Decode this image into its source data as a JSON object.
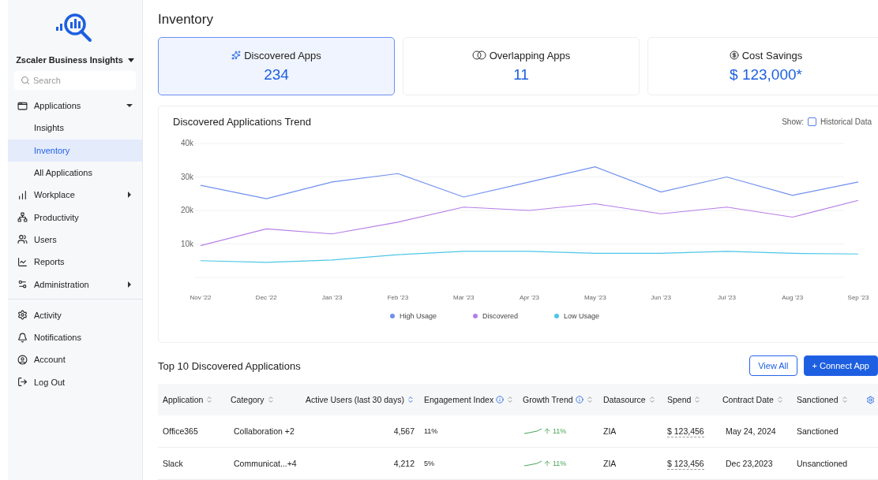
{
  "sidebar": {
    "brand": "Zscaler Business Insights",
    "search": {
      "placeholder": "Search"
    },
    "items": [
      {
        "label": "Applications",
        "expanded": true,
        "children": [
          {
            "label": "Insights",
            "selected": false
          },
          {
            "label": "Inventory",
            "selected": true
          },
          {
            "label": "All Applications",
            "selected": false
          }
        ]
      },
      {
        "label": "Workplace",
        "expanded": false
      },
      {
        "label": "Productivity"
      },
      {
        "label": "Users"
      },
      {
        "label": "Reports"
      },
      {
        "label": "Administration",
        "expanded": false
      }
    ],
    "footer_items": [
      {
        "label": "Activity"
      },
      {
        "label": "Notifications"
      },
      {
        "label": "Account"
      },
      {
        "label": "Log Out"
      }
    ]
  },
  "page_title": "Inventory",
  "cards": [
    {
      "label": "Discovered Apps",
      "value": "234",
      "selected": true
    },
    {
      "label": "Overlapping Apps",
      "value": "11",
      "selected": false
    },
    {
      "label": "Cost Savings",
      "value": "$ 123,000*",
      "selected": false
    }
  ],
  "trend": {
    "title": "Discovered Applications Trend",
    "show_label": "Show:",
    "historical": {
      "label": "Historical Data",
      "checked": false
    },
    "chart_data": {
      "type": "line",
      "x": [
        "Nov '22",
        "Dec '22",
        "Jan '23",
        "Feb '23",
        "Mar '23",
        "Apr '23",
        "May '23",
        "Jun '23",
        "Jul '23",
        "Aug '23",
        "Sep '23"
      ],
      "ylim": [
        0,
        40000
      ],
      "grid": true,
      "yticks": [
        {
          "value": 10000,
          "label": "10k"
        },
        {
          "value": 20000,
          "label": "20k"
        },
        {
          "value": 30000,
          "label": "30k"
        },
        {
          "value": 40000,
          "label": "40k"
        }
      ],
      "series": [
        {
          "name": "High Usage",
          "color": "#6f8ff0",
          "values": [
            27500,
            23500,
            28500,
            31000,
            24000,
            28500,
            33000,
            25500,
            30000,
            24500,
            28500
          ]
        },
        {
          "name": "Discovered",
          "color": "#b57ee8",
          "values": [
            9500,
            14500,
            13000,
            16500,
            21000,
            20000,
            22000,
            19000,
            21000,
            18000,
            23000
          ]
        },
        {
          "name": "Low Usage",
          "color": "#4ec6e8",
          "values": [
            5000,
            4500,
            5200,
            6800,
            7800,
            7800,
            7200,
            7200,
            7800,
            7200,
            7000
          ]
        }
      ]
    }
  },
  "table": {
    "title": "Top 10 Discovered Applications",
    "buttons": [
      {
        "label": "View All",
        "kind": "outline"
      },
      {
        "label": "+  Connect App",
        "kind": "primary"
      }
    ],
    "columns": [
      {
        "label": "Application",
        "sorted": false,
        "info": false
      },
      {
        "label": "Category",
        "sorted": false,
        "info": false
      },
      {
        "label": "Active Users (last 30 days)",
        "sorted": true,
        "info": false
      },
      {
        "label": "Engagement Index",
        "sorted": false,
        "info": true
      },
      {
        "label": "Growth Trend",
        "sorted": false,
        "info": true
      },
      {
        "label": "Datasource",
        "sorted": false,
        "info": false
      },
      {
        "label": "Spend",
        "sorted": false,
        "info": false
      },
      {
        "label": "Contract Date",
        "sorted": false,
        "info": false
      },
      {
        "label": "Sanctioned",
        "sorted": false,
        "info": false
      }
    ],
    "rows": [
      {
        "application": "Office365",
        "category": "Collaboration +2",
        "active_users": "4,567",
        "engagement": "11%",
        "growth": "11%",
        "datasource": "ZIA",
        "spend": "$ 123,456",
        "contract_date": "May 24, 2024",
        "sanctioned": "Sanctioned"
      },
      {
        "application": "Slack",
        "category": "Communicat...+4",
        "active_users": "4,212",
        "engagement": "5%",
        "growth": "11%",
        "datasource": "ZIA",
        "spend": "$ 123,456",
        "contract_date": "Dec 23,2023",
        "sanctioned": "Unsanctioned"
      }
    ]
  }
}
